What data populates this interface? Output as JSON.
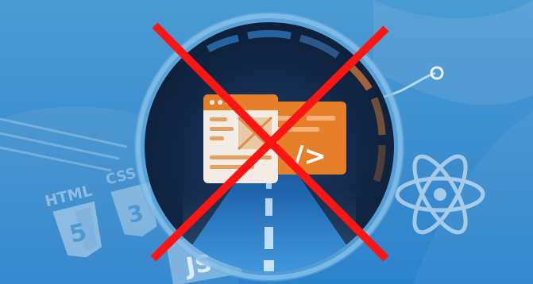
{
  "illustration": {
    "html_label": "HTML",
    "css_label": "CSS",
    "js_label": "JS",
    "code_glyph": "/>"
  },
  "colors": {
    "background_top": "#3f92d0",
    "background_bottom": "#2f86cf",
    "ring": "#5aa3dc",
    "tunnel_dark": "#10233f",
    "window_orange": "#e57f2a",
    "window_light": "#f2ece4",
    "cross_red": "#ff1414"
  }
}
